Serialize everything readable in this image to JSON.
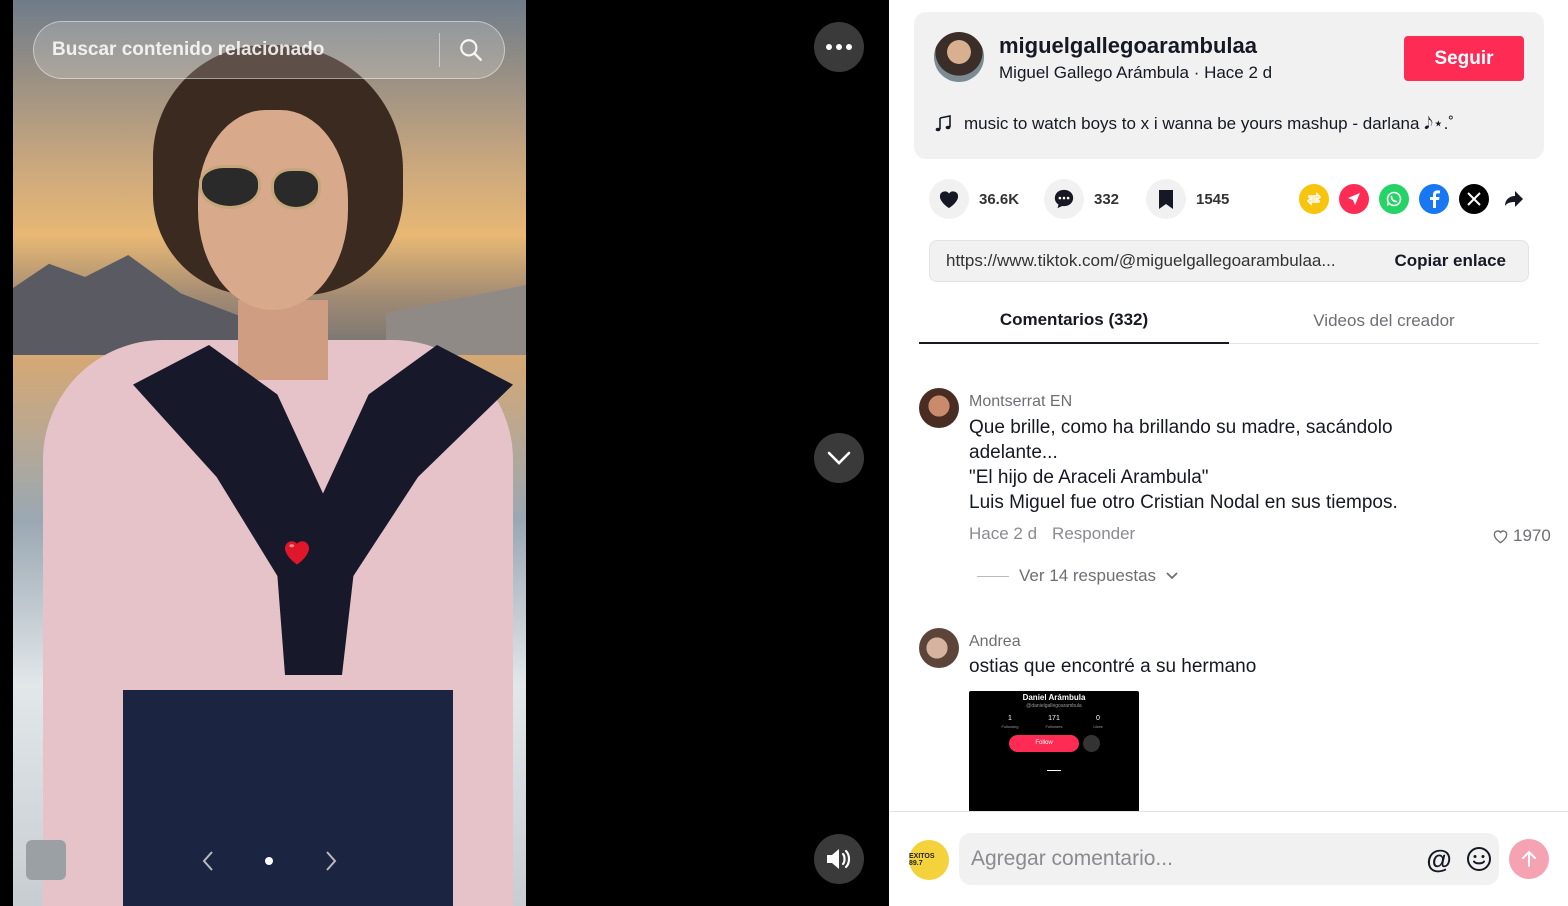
{
  "stage": {
    "search_placeholder": "Buscar contenido relacionado"
  },
  "post": {
    "username": "miguelgallegoarambulaa",
    "display_name": "Miguel Gallego Arámbula",
    "age": "Hace 2 d",
    "follow_label": "Seguir",
    "music": "music to watch boys to x i wanna be yours mashup - darlana 𝅘𝅥𝅮⋆.˚"
  },
  "stats": {
    "likes": "36.6K",
    "comments": "332",
    "saves": "1545"
  },
  "link": {
    "url": "https://www.tiktok.com/@miguelgallegoarambulaa...",
    "copy_label": "Copiar enlace"
  },
  "tabs": {
    "comments": "Comentarios (332)",
    "creator": "Videos del creador"
  },
  "comments": [
    {
      "name": "Montserrat EN",
      "lines": [
        "Que brille, como ha brillando su madre, sacándolo",
        "adelante...",
        "\"El hijo de Araceli Arambula\"",
        "Luis Miguel fue otro Cristian Nodal en sus tiempos."
      ],
      "time": "Hace 2 d",
      "reply_label": "Responder",
      "likes": "1970",
      "view_replies": "Ver 14 respuestas"
    },
    {
      "name": "Andrea",
      "text": "ostias que encontré a su hermano",
      "image": {
        "name": "Daniel Arámbula",
        "handle": "@danielgallegoarambula",
        "following": "1",
        "following_label": "Following",
        "followers": "171",
        "followers_label": "Followers",
        "likes": "0",
        "likes_label": "Likes",
        "follow_label": "Follow"
      }
    }
  ],
  "composer": {
    "placeholder": "Agregar comentario...",
    "at": "@",
    "avatar_text": "EXITOS 89.7"
  },
  "colors": {
    "accent": "#fe2c55",
    "repost": "#f9c40e",
    "send": "#fe2c55",
    "whatsapp": "#25d366",
    "facebook": "#1877f2"
  }
}
